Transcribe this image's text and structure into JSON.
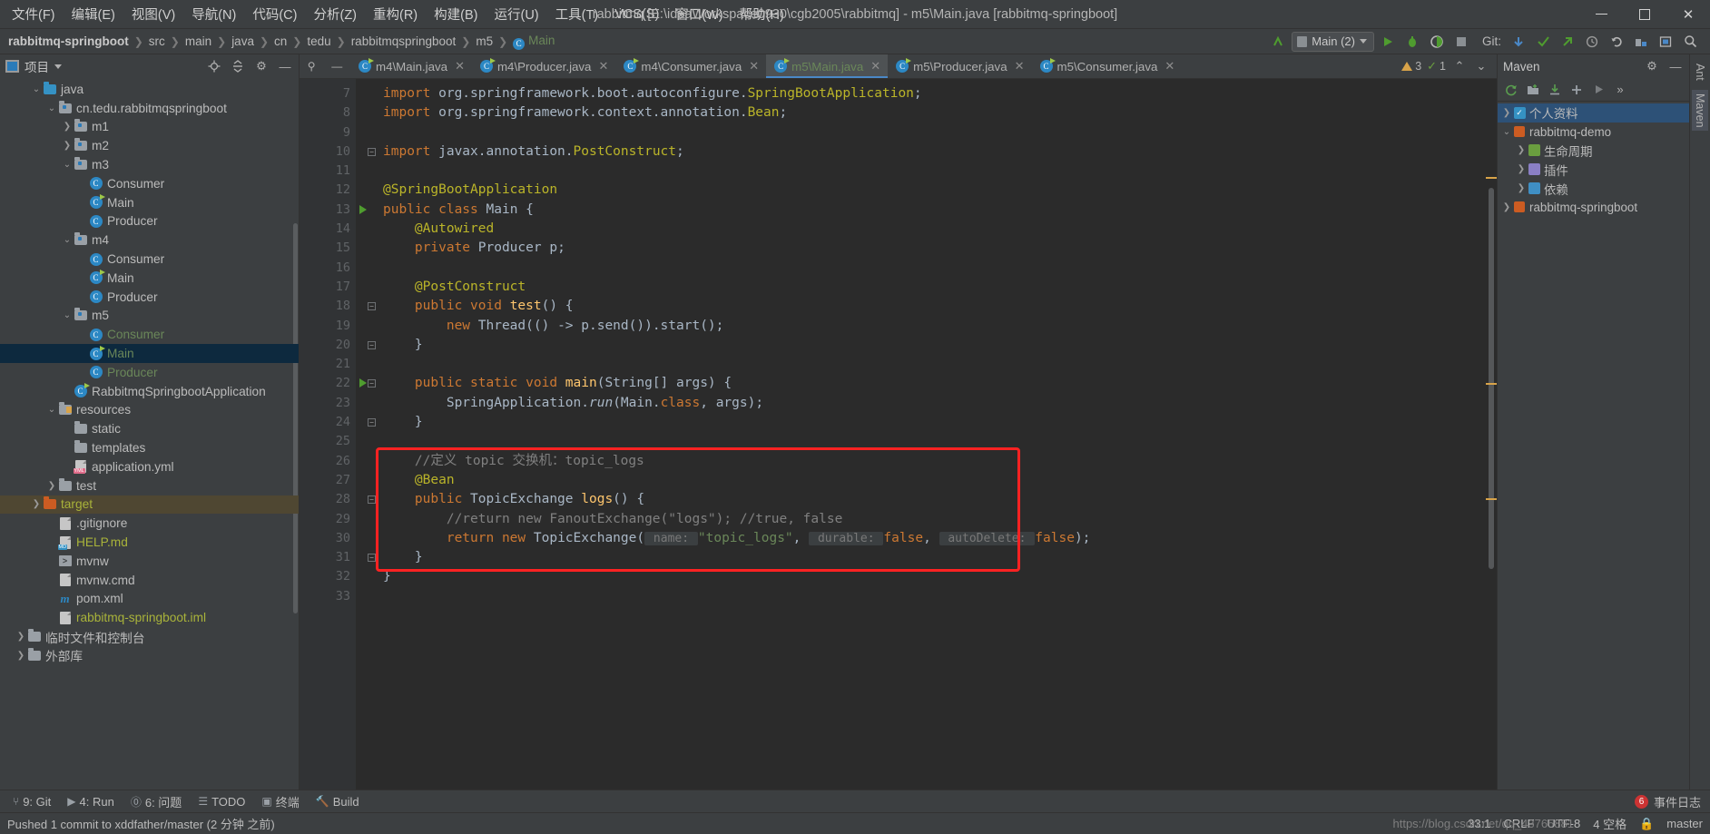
{
  "window": {
    "title": "rabbitmq [E:\\ideaWorkspace0930\\cgb2005\\rabbitmq] - m5\\Main.java [rabbitmq-springboot]",
    "minimize": "—",
    "maximize": "□",
    "close": "✕"
  },
  "menu": [
    {
      "label": "文件(F)"
    },
    {
      "label": "编辑(E)"
    },
    {
      "label": "视图(V)"
    },
    {
      "label": "导航(N)"
    },
    {
      "label": "代码(C)"
    },
    {
      "label": "分析(Z)"
    },
    {
      "label": "重构(R)"
    },
    {
      "label": "构建(B)"
    },
    {
      "label": "运行(U)"
    },
    {
      "label": "工具(T)"
    },
    {
      "label": "VCS(S)"
    },
    {
      "label": "窗口(W)"
    },
    {
      "label": "帮助(H)"
    }
  ],
  "breadcrumb": [
    {
      "label": "rabbitmq-springboot",
      "style": "bold"
    },
    {
      "label": "src",
      "style": "plain"
    },
    {
      "label": "main",
      "style": "plain"
    },
    {
      "label": "java",
      "style": "plain"
    },
    {
      "label": "cn",
      "style": "plain"
    },
    {
      "label": "tedu",
      "style": "plain"
    },
    {
      "label": "rabbitmqspringboot",
      "style": "plain"
    },
    {
      "label": "m5",
      "style": "plain"
    },
    {
      "label": "Main",
      "style": "green"
    }
  ],
  "toolbar": {
    "run_config": "Main (2)",
    "git_label": "Git:",
    "icons": [
      "back-arrow-icon",
      "run-icon",
      "debug-icon",
      "run-coverage-icon",
      "stop-icon",
      "git-update-icon",
      "git-commit-icon",
      "git-push-icon",
      "git-history-icon",
      "git-rollback-icon",
      "build-icon",
      "layout-icon",
      "search-icon"
    ]
  },
  "project_panel": {
    "title": "项目",
    "tree": [
      {
        "label": "java",
        "indent": 2,
        "arrow": "down",
        "icon": "folder-blue",
        "color": "white",
        "partial": true
      },
      {
        "label": "cn.tedu.rabbitmqspringboot",
        "indent": 3,
        "arrow": "down",
        "icon": "folder-pkg",
        "color": "white"
      },
      {
        "label": "m1",
        "indent": 4,
        "arrow": "right",
        "icon": "folder-pkg",
        "color": "white"
      },
      {
        "label": "m2",
        "indent": 4,
        "arrow": "right",
        "icon": "folder-pkg",
        "color": "white"
      },
      {
        "label": "m3",
        "indent": 4,
        "arrow": "down",
        "icon": "folder-pkg",
        "color": "white"
      },
      {
        "label": "Consumer",
        "indent": 5,
        "arrow": "none",
        "icon": "class",
        "color": "white"
      },
      {
        "label": "Main",
        "indent": 5,
        "arrow": "none",
        "icon": "class-run",
        "color": "white"
      },
      {
        "label": "Producer",
        "indent": 5,
        "arrow": "none",
        "icon": "class",
        "color": "white"
      },
      {
        "label": "m4",
        "indent": 4,
        "arrow": "down",
        "icon": "folder-pkg",
        "color": "white"
      },
      {
        "label": "Consumer",
        "indent": 5,
        "arrow": "none",
        "icon": "class",
        "color": "white"
      },
      {
        "label": "Main",
        "indent": 5,
        "arrow": "none",
        "icon": "class-run",
        "color": "white"
      },
      {
        "label": "Producer",
        "indent": 5,
        "arrow": "none",
        "icon": "class",
        "color": "white"
      },
      {
        "label": "m5",
        "indent": 4,
        "arrow": "down",
        "icon": "folder-pkg",
        "color": "white"
      },
      {
        "label": "Consumer",
        "indent": 5,
        "arrow": "none",
        "icon": "class",
        "color": "green"
      },
      {
        "label": "Main",
        "indent": 5,
        "arrow": "none",
        "icon": "class-run",
        "color": "green",
        "selected": true
      },
      {
        "label": "Producer",
        "indent": 5,
        "arrow": "none",
        "icon": "class",
        "color": "green"
      },
      {
        "label": "RabbitmqSpringbootApplication",
        "indent": 4,
        "arrow": "none",
        "icon": "class-run",
        "color": "white"
      },
      {
        "label": "resources",
        "indent": 3,
        "arrow": "down",
        "icon": "folder-res",
        "color": "white"
      },
      {
        "label": "static",
        "indent": 4,
        "arrow": "none",
        "icon": "folder-plain",
        "color": "white"
      },
      {
        "label": "templates",
        "indent": 4,
        "arrow": "none",
        "icon": "folder-plain",
        "color": "white"
      },
      {
        "label": "application.yml",
        "indent": 4,
        "arrow": "none",
        "icon": "file-yml",
        "color": "white"
      },
      {
        "label": "test",
        "indent": 3,
        "arrow": "right",
        "icon": "folder-plain",
        "color": "white"
      },
      {
        "label": "target",
        "indent": 2,
        "arrow": "right",
        "icon": "folder-orange",
        "color": "olive",
        "amber": true
      },
      {
        "label": ".gitignore",
        "indent": 3,
        "arrow": "none",
        "icon": "file-git",
        "color": "white"
      },
      {
        "label": "HELP.md",
        "indent": 3,
        "arrow": "none",
        "icon": "file-md",
        "color": "olive"
      },
      {
        "label": "mvnw",
        "indent": 3,
        "arrow": "none",
        "icon": "file-sh",
        "color": "white"
      },
      {
        "label": "mvnw.cmd",
        "indent": 3,
        "arrow": "none",
        "icon": "file-cmd",
        "color": "white"
      },
      {
        "label": "pom.xml",
        "indent": 3,
        "arrow": "none",
        "icon": "file-maven",
        "color": "white"
      },
      {
        "label": "rabbitmq-springboot.iml",
        "indent": 3,
        "arrow": "none",
        "icon": "file-iml",
        "color": "olive"
      },
      {
        "label": "临时文件和控制台",
        "indent": 1,
        "arrow": "right",
        "icon": "folder-plain",
        "color": "white"
      },
      {
        "label": "外部库",
        "indent": 1,
        "arrow": "right",
        "icon": "folder-plain",
        "color": "white",
        "partial": true
      }
    ]
  },
  "editor": {
    "tabs": [
      {
        "label": "m4\\Main.java",
        "active": false
      },
      {
        "label": "m4\\Producer.java",
        "active": false
      },
      {
        "label": "m4\\Consumer.java",
        "active": false
      },
      {
        "label": "m5\\Main.java",
        "active": true
      },
      {
        "label": "m5\\Producer.java",
        "active": false
      },
      {
        "label": "m5\\Consumer.java",
        "active": false
      }
    ],
    "close_glyph": "✕",
    "inspection": {
      "warnings": "3",
      "weak_warnings": "1"
    },
    "first_line_number": 7,
    "lines": [
      {
        "n": 7,
        "run": false,
        "fold": false,
        "tokens": [
          {
            "t": "import ",
            "c": "kw"
          },
          {
            "t": "org.springframework.boot.autoconfigure.",
            "c": "plain"
          },
          {
            "t": "SpringBootApplication",
            "c": "ann"
          },
          {
            "t": ";",
            "c": "plain"
          }
        ]
      },
      {
        "n": 8,
        "run": false,
        "fold": false,
        "tokens": [
          {
            "t": "import ",
            "c": "kw"
          },
          {
            "t": "org.springframework.context.annotation.",
            "c": "plain"
          },
          {
            "t": "Bean",
            "c": "ann"
          },
          {
            "t": ";",
            "c": "plain"
          }
        ]
      },
      {
        "n": 9,
        "run": false,
        "fold": false,
        "tokens": []
      },
      {
        "n": 10,
        "run": false,
        "fold": true,
        "tokens": [
          {
            "t": "import ",
            "c": "kw"
          },
          {
            "t": "javax.annotation.",
            "c": "plain"
          },
          {
            "t": "PostConstruct",
            "c": "ann"
          },
          {
            "t": ";",
            "c": "plain"
          }
        ]
      },
      {
        "n": 11,
        "run": false,
        "fold": false,
        "tokens": []
      },
      {
        "n": 12,
        "run": false,
        "fold": false,
        "tokens": [
          {
            "t": "@SpringBootApplication",
            "c": "ann"
          }
        ]
      },
      {
        "n": 13,
        "run": true,
        "fold": false,
        "tokens": [
          {
            "t": "public class ",
            "c": "kw"
          },
          {
            "t": "Main",
            "c": "plain"
          },
          {
            "t": " {",
            "c": "plain"
          }
        ]
      },
      {
        "n": 14,
        "run": false,
        "fold": false,
        "tokens": [
          {
            "t": "    @Autowired",
            "c": "ann"
          }
        ]
      },
      {
        "n": 15,
        "run": false,
        "fold": false,
        "tokens": [
          {
            "t": "    private ",
            "c": "kw"
          },
          {
            "t": "Producer p;",
            "c": "plain"
          }
        ]
      },
      {
        "n": 16,
        "run": false,
        "fold": false,
        "tokens": []
      },
      {
        "n": 17,
        "run": false,
        "fold": false,
        "tokens": [
          {
            "t": "    @PostConstruct",
            "c": "ann"
          }
        ]
      },
      {
        "n": 18,
        "run": false,
        "fold": true,
        "tokens": [
          {
            "t": "    public void ",
            "c": "kw"
          },
          {
            "t": "test",
            "c": "meth"
          },
          {
            "t": "() {",
            "c": "plain"
          }
        ]
      },
      {
        "n": 19,
        "run": false,
        "fold": false,
        "tokens": [
          {
            "t": "        ",
            "c": "plain"
          },
          {
            "t": "new ",
            "c": "kw"
          },
          {
            "t": "Thread(() -> p.send()).start();",
            "c": "plain"
          }
        ]
      },
      {
        "n": 20,
        "run": false,
        "fold": true,
        "tokens": [
          {
            "t": "    }",
            "c": "plain"
          }
        ]
      },
      {
        "n": 21,
        "run": false,
        "fold": false,
        "tokens": []
      },
      {
        "n": 22,
        "run": true,
        "fold": true,
        "tokens": [
          {
            "t": "    public static void ",
            "c": "kw"
          },
          {
            "t": "main",
            "c": "meth"
          },
          {
            "t": "(String[] args) {",
            "c": "plain"
          }
        ]
      },
      {
        "n": 23,
        "run": false,
        "fold": false,
        "tokens": [
          {
            "t": "        SpringApplication.",
            "c": "plain"
          },
          {
            "t": "run",
            "c": "stat"
          },
          {
            "t": "(Main.",
            "c": "plain"
          },
          {
            "t": "class",
            "c": "kw"
          },
          {
            "t": ", args);",
            "c": "plain"
          }
        ]
      },
      {
        "n": 24,
        "run": false,
        "fold": true,
        "tokens": [
          {
            "t": "    }",
            "c": "plain"
          }
        ]
      },
      {
        "n": 25,
        "run": false,
        "fold": false,
        "tokens": []
      },
      {
        "n": 26,
        "run": false,
        "fold": false,
        "tokens": [
          {
            "t": "    //定义 topic 交换机：topic_logs",
            "c": "cmt"
          }
        ]
      },
      {
        "n": 27,
        "run": false,
        "fold": false,
        "tokens": [
          {
            "t": "    @Bean",
            "c": "ann"
          }
        ]
      },
      {
        "n": 28,
        "run": false,
        "fold": true,
        "tokens": [
          {
            "t": "    public ",
            "c": "kw"
          },
          {
            "t": "TopicExchange ",
            "c": "plain"
          },
          {
            "t": "logs",
            "c": "meth"
          },
          {
            "t": "() {",
            "c": "plain"
          }
        ]
      },
      {
        "n": 29,
        "run": false,
        "fold": false,
        "tokens": [
          {
            "t": "        //return new FanoutExchange(\"logs\"); //true, false",
            "c": "cmt"
          }
        ]
      },
      {
        "n": 30,
        "run": false,
        "fold": false,
        "tokens": [
          {
            "t": "        ",
            "c": "plain"
          },
          {
            "t": "return new ",
            "c": "kw"
          },
          {
            "t": "TopicExchange(",
            "c": "plain"
          },
          {
            "t": " name: ",
            "c": "hint"
          },
          {
            "t": "\"topic_logs\"",
            "c": "str"
          },
          {
            "t": ", ",
            "c": "plain"
          },
          {
            "t": " durable: ",
            "c": "hint"
          },
          {
            "t": "false",
            "c": "kw"
          },
          {
            "t": ", ",
            "c": "plain"
          },
          {
            "t": " autoDelete: ",
            "c": "hint"
          },
          {
            "t": "false",
            "c": "kw"
          },
          {
            "t": ");",
            "c": "plain"
          }
        ]
      },
      {
        "n": 31,
        "run": false,
        "fold": true,
        "tokens": [
          {
            "t": "    }",
            "c": "plain"
          }
        ]
      },
      {
        "n": 32,
        "run": false,
        "fold": false,
        "tokens": [
          {
            "t": "}",
            "c": "plain"
          }
        ]
      },
      {
        "n": 33,
        "run": false,
        "fold": false,
        "tokens": []
      }
    ],
    "highlight_box": {
      "color": "#ff2222",
      "from_line": 26,
      "to_line": 31
    }
  },
  "maven": {
    "title": "Maven",
    "tree": [
      {
        "label": "个人资料",
        "indent": 0,
        "arrow": "right",
        "icon": "profile-check",
        "selected": true
      },
      {
        "label": "rabbitmq-demo",
        "indent": 0,
        "arrow": "down",
        "icon": "maven-project"
      },
      {
        "label": "生命周期",
        "indent": 1,
        "arrow": "right",
        "icon": "lifecycle"
      },
      {
        "label": "插件",
        "indent": 1,
        "arrow": "right",
        "icon": "plugins"
      },
      {
        "label": "依赖",
        "indent": 1,
        "arrow": "right",
        "icon": "dependencies"
      },
      {
        "label": "rabbitmq-springboot",
        "indent": 0,
        "arrow": "right",
        "icon": "maven-project"
      }
    ],
    "toolbar_icons": [
      "refresh-icon",
      "add-maven-project-icon",
      "download-sources-icon",
      "add-icon",
      "run-icon",
      "expand-icon"
    ]
  },
  "right_strip": [
    {
      "label": "Ant",
      "selected": false
    },
    {
      "label": "Maven",
      "selected": true
    }
  ],
  "bottom_toolwindows": [
    {
      "label": "9: Git",
      "icon": "git-icon"
    },
    {
      "label": "4: Run",
      "icon": "run-icon"
    },
    {
      "label": "6: 问题",
      "icon": "problems-icon"
    },
    {
      "label": "TODO",
      "icon": "todo-icon"
    },
    {
      "label": "终端",
      "icon": "terminal-icon"
    },
    {
      "label": "Build",
      "icon": "build-icon"
    }
  ],
  "event_log": {
    "label": "事件日志",
    "count": "6"
  },
  "status_bar": {
    "message": "Pushed 1 commit to xddfather/master (2 分钟 之前)",
    "caret": "33:1",
    "line_sep": "CRLF",
    "encoding": "UTF-8",
    "indent": "4 空格",
    "branch": "master",
    "watermark": "https://blog.csdn.net/qq_43765881"
  }
}
